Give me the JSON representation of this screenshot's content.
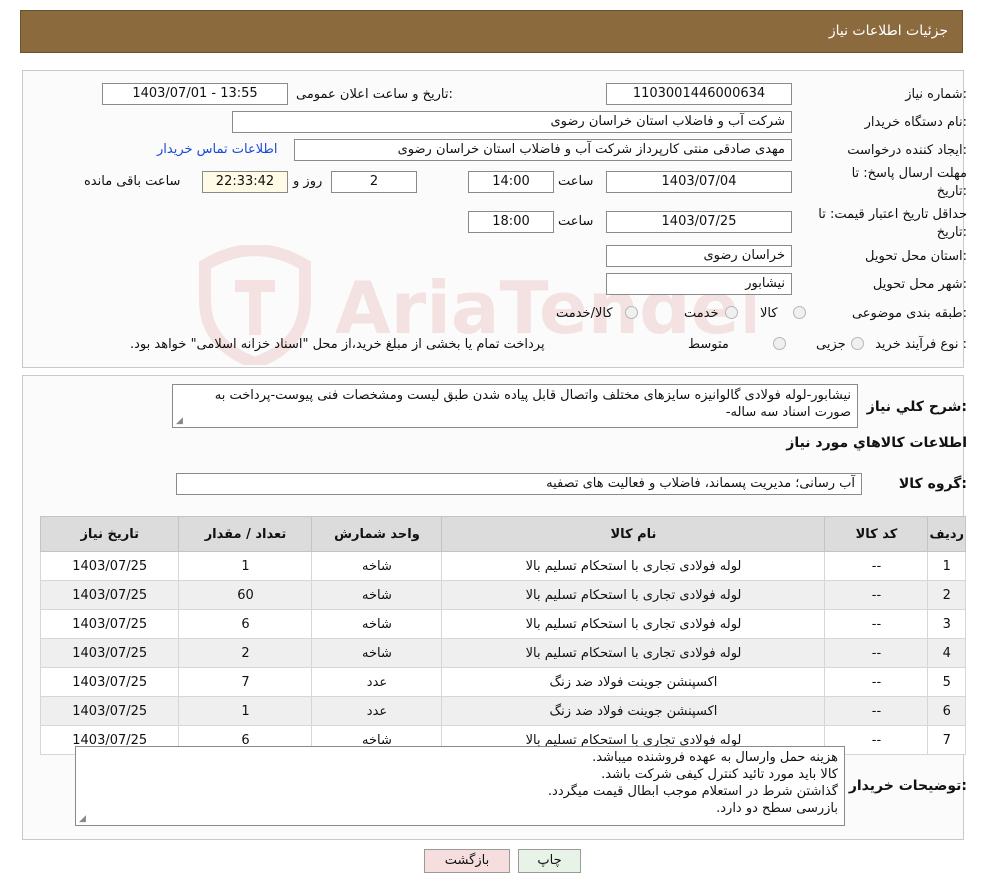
{
  "header": {
    "title": "جزئیات اطلاعات نیاز"
  },
  "form": {
    "need_number_label": "شماره نیاز:",
    "need_number": "1103001446000634",
    "announce_label": "تاریخ و ساعت اعلان عمومی:",
    "announce_value": "1403/07/01 - 13:55",
    "buyer_org_label": "نام دستگاه خریدار:",
    "buyer_org": "شرکت آب و فاضلاب استان خراسان رضوی",
    "requester_label": "ایجاد کننده درخواست:",
    "requester": "مهدی صادقی منتی کارپرداز شرکت آب و فاضلاب استان خراسان رضوی",
    "contact_link": "اطلاعات تماس خریدار",
    "reply_deadline_label_1": "مهلت ارسال پاسخ: تا",
    "reply_deadline_label_2": "تاریخ:",
    "reply_date": "1403/07/04",
    "time_label": "ساعت",
    "reply_time": "14:00",
    "days_value": "2",
    "days_label": "روز و",
    "remaining_time": "22:33:42",
    "remaining_label": "ساعت باقی مانده",
    "price_validity_label_1": "حداقل تاریخ اعتبار قیمت: تا",
    "price_validity_label_2": "تاریخ:",
    "validity_date": "1403/07/25",
    "validity_time": "18:00",
    "province_label": "استان محل تحویل:",
    "province": "خراسان رضوی",
    "city_label": "شهر محل تحویل:",
    "city": "نیشابور",
    "category_label": "طبقه بندی موضوعی:",
    "category_options": [
      "کالا",
      "خدمت",
      "کالا/خدمت"
    ],
    "process_label": "نوع فرآیند خرید :",
    "process_options": [
      "جزیی",
      "متوسط"
    ],
    "payment_note": "پرداخت تمام یا بخشی از مبلغ خرید،از محل \"اسناد خزانه اسلامی\" خواهد بود."
  },
  "summary": {
    "label": "شرح کلي نياز:",
    "text": "نیشابور-لوله فولادی گالوانیزه سایزهای مختلف واتصال قابل پیاده شدن طبق لیست ومشخصات فنی پیوست-پرداخت به صورت اسناد سه ساله-",
    "goods_info_title": "اطلاعات کالاهاي مورد نياز",
    "group_label": "گروه کالا:",
    "group_value": "آب رسانی؛ مدیریت پسماند، فاضلاب و فعالیت های تصفیه"
  },
  "table": {
    "headers": [
      "ردیف",
      "کد کالا",
      "نام کالا",
      "واحد شمارش",
      "تعداد / مقدار",
      "تاریخ نیاز"
    ],
    "rows": [
      [
        "1",
        "--",
        "لوله فولادی تجاری با استحکام تسلیم بالا",
        "شاخه",
        "1",
        "1403/07/25"
      ],
      [
        "2",
        "--",
        "لوله فولادی تجاری با استحکام تسلیم بالا",
        "شاخه",
        "60",
        "1403/07/25"
      ],
      [
        "3",
        "--",
        "لوله فولادی تجاری با استحکام تسلیم بالا",
        "شاخه",
        "6",
        "1403/07/25"
      ],
      [
        "4",
        "--",
        "لوله فولادی تجاری با استحکام تسلیم بالا",
        "شاخه",
        "2",
        "1403/07/25"
      ],
      [
        "5",
        "--",
        "اکسپنشن جوینت فولاد ضد زنگ",
        "عدد",
        "7",
        "1403/07/25"
      ],
      [
        "6",
        "--",
        "اکسپنشن جوینت فولاد ضد زنگ",
        "عدد",
        "1",
        "1403/07/25"
      ],
      [
        "7",
        "--",
        "لوله فولادی تجاری با استحکام تسلیم بالا",
        "شاخه",
        "6",
        "1403/07/25"
      ]
    ]
  },
  "buyer_notes": {
    "label": "توضیحات خریدار:",
    "lines": [
      "هزینه حمل وارسال به عهده فروشنده میباشد.",
      "کالا باید مورد تائید کنترل کیفی شرکت باشد.",
      "گذاشتن شرط در استعلام موجب ابطال قیمت میگردد.",
      "بازرسی سطح دو دارد."
    ]
  },
  "buttons": {
    "print": "چاپ",
    "back": "بازگشت"
  },
  "watermark": {
    "text": "AriaTender.neT"
  }
}
